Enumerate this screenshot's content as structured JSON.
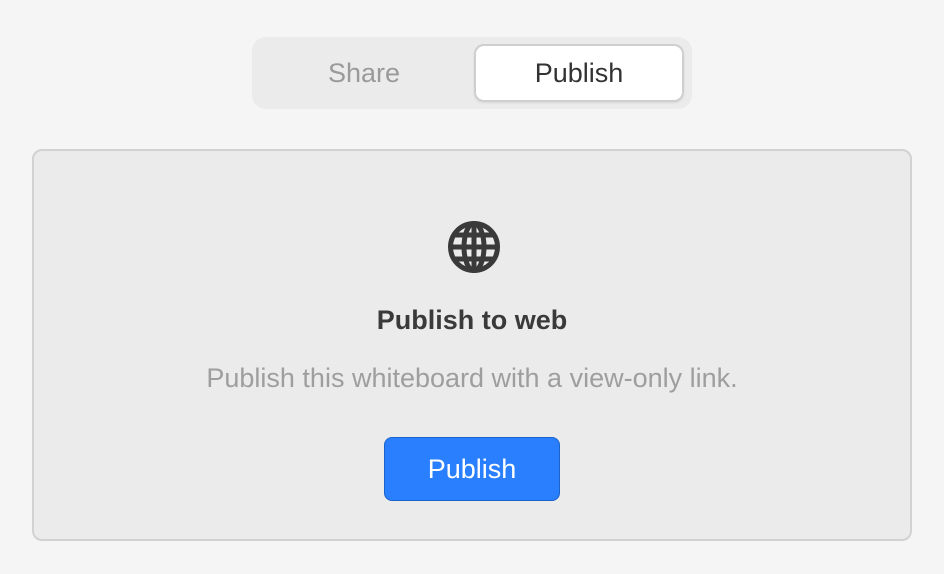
{
  "tabs": {
    "items": [
      {
        "label": "Share",
        "active": false
      },
      {
        "label": "Publish",
        "active": true
      }
    ]
  },
  "panel": {
    "icon": "globe-icon",
    "title": "Publish to web",
    "description": "Publish this whiteboard with a view-only link.",
    "button_label": "Publish"
  },
  "colors": {
    "background": "#f5f5f5",
    "panel": "#ebebeb",
    "accent": "#2a7fff",
    "icon": "#3a3a3a"
  }
}
